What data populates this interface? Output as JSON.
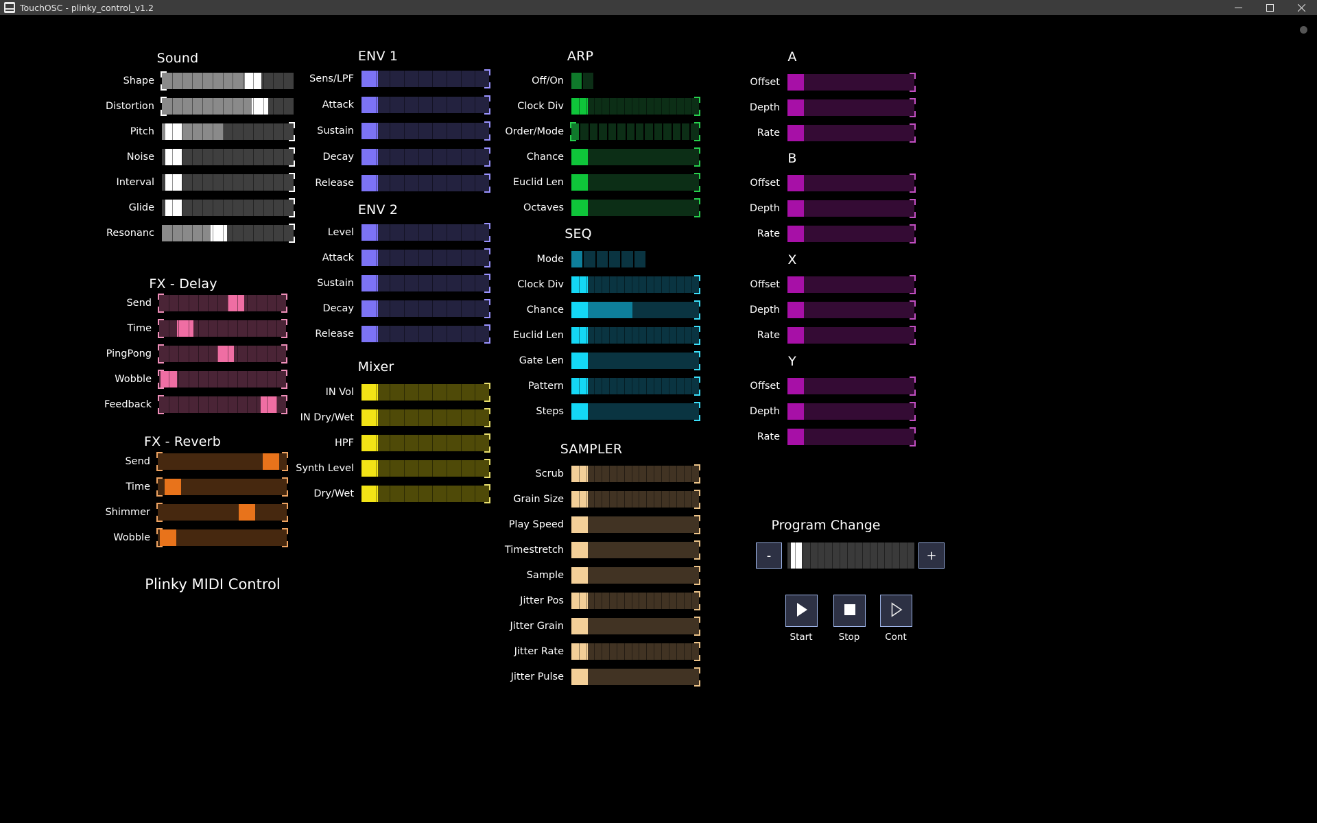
{
  "window": {
    "title": "TouchOSC - plinky_control_v1.2",
    "icon": "app-icon",
    "buttons": [
      {
        "name": "minimize",
        "glyph": "minimize-icon"
      },
      {
        "name": "maximize",
        "glyph": "maximize-icon"
      },
      {
        "name": "close",
        "glyph": "close-icon"
      }
    ]
  },
  "footer_title": "Plinky MIDI Control",
  "palettes": {
    "grey": {
      "track": "#3f3f3f",
      "fill": "#8a8a8a",
      "thumb": "#ffffff",
      "bracket": "#ffffff"
    },
    "blue": {
      "track": "#23223f",
      "fill": "#6c63e8",
      "thumb": "#7c73f5",
      "bracket": "#9a93ff"
    },
    "pink": {
      "track": "#4a2436",
      "fill": "#9c3c63",
      "thumb": "#ef6ea3",
      "bracket": "#f08fba"
    },
    "orange": {
      "track": "#46280f",
      "fill": "#8c4b17",
      "thumb": "#e8731b",
      "bracket": "#efa462"
    },
    "yellow": {
      "track": "#4f4a08",
      "fill": "#807a12",
      "thumb": "#f2e316",
      "bracket": "#e9df6e"
    },
    "green": {
      "track": "#0c2e16",
      "fill": "#0f7a2b",
      "thumb": "#0fc53a",
      "bracket": "#27d04d"
    },
    "cyan": {
      "track": "#0a3441",
      "fill": "#0e7f9b",
      "thumb": "#14d7f5",
      "bracket": "#3ce0fa"
    },
    "brown": {
      "track": "#413323",
      "fill": "#6b5436",
      "thumb": "#f3cf98",
      "bracket": "#edc489"
    },
    "purple": {
      "track": "#340b34",
      "fill": "#6a0f6a",
      "thumb": "#a710a7",
      "bracket": "#c24fc2"
    }
  },
  "groups": [
    {
      "id": "sound",
      "title": "Sound",
      "palette": "grey",
      "rows": [
        {
          "label": "Shape",
          "type": "fader",
          "fill": 0.72,
          "thumb": 0.72,
          "ticks": 13,
          "brackets": "left"
        },
        {
          "label": "Distortion",
          "type": "fader",
          "fill": 0.78,
          "thumb": 0.78,
          "ticks": 13,
          "brackets": "left"
        },
        {
          "label": "Pitch",
          "type": "fader",
          "fill": 0.47,
          "thumb": 0.03,
          "ticks": 13,
          "brackets": "right"
        },
        {
          "label": "Noise",
          "type": "fader",
          "fill": 0.0,
          "thumb": 0.03,
          "ticks": 13,
          "brackets": "right"
        },
        {
          "label": "Interval",
          "type": "fader",
          "fill": 0.0,
          "thumb": 0.03,
          "ticks": 13,
          "brackets": "right"
        },
        {
          "label": "Glide",
          "type": "fader",
          "fill": 0.0,
          "thumb": 0.03,
          "ticks": 13,
          "brackets": "right"
        },
        {
          "label": "Resonanc",
          "type": "fader",
          "fill": 0.42,
          "thumb": 0.42,
          "ticks": 13,
          "brackets": "right"
        }
      ]
    },
    {
      "id": "fx-delay",
      "title": "FX - Delay",
      "palette": "pink",
      "rows": [
        {
          "label": "Send",
          "type": "fader",
          "fill": 0.0,
          "thumb": 0.62,
          "ticks": 13,
          "brackets": "both"
        },
        {
          "label": "Time",
          "type": "fader",
          "fill": 0.0,
          "thumb": 0.16,
          "ticks": 13,
          "brackets": "both"
        },
        {
          "label": "PingPong",
          "type": "fader",
          "fill": 0.0,
          "thumb": 0.53,
          "ticks": 13,
          "brackets": "both"
        },
        {
          "label": "Wobble",
          "type": "fader",
          "fill": 0.0,
          "thumb": 0.01,
          "ticks": 13,
          "brackets": "both"
        },
        {
          "label": "Feedback",
          "type": "fader",
          "fill": 0.0,
          "thumb": 0.92,
          "ticks": 13,
          "brackets": "both"
        }
      ]
    },
    {
      "id": "fx-reverb",
      "title": "FX - Reverb",
      "palette": "orange",
      "rows": [
        {
          "label": "Send",
          "type": "fader",
          "fill": 0.0,
          "thumb": 0.93,
          "ticks": 0,
          "brackets": "both"
        },
        {
          "label": "Time",
          "type": "fader",
          "fill": 0.0,
          "thumb": 0.06,
          "ticks": 0,
          "brackets": "both"
        },
        {
          "label": "Shimmer",
          "type": "fader",
          "fill": 0.0,
          "thumb": 0.72,
          "ticks": 0,
          "brackets": "both"
        },
        {
          "label": "Wobble",
          "type": "fader",
          "fill": 0.0,
          "thumb": 0.02,
          "ticks": 0,
          "brackets": "both"
        }
      ]
    },
    {
      "id": "env1",
      "title": "ENV 1",
      "palette": "blue",
      "rows": [
        {
          "label": "Sens/LPF",
          "type": "fader",
          "fill": 0.0,
          "thumb": 0.0,
          "ticks": 9,
          "brackets": "right"
        },
        {
          "label": "Attack",
          "type": "fader",
          "fill": 0.0,
          "thumb": 0.0,
          "ticks": 9,
          "brackets": "right"
        },
        {
          "label": "Sustain",
          "type": "fader",
          "fill": 0.0,
          "thumb": 0.0,
          "ticks": 9,
          "brackets": "right"
        },
        {
          "label": "Decay",
          "type": "fader",
          "fill": 0.0,
          "thumb": 0.0,
          "ticks": 9,
          "brackets": "right"
        },
        {
          "label": "Release",
          "type": "fader",
          "fill": 0.0,
          "thumb": 0.0,
          "ticks": 9,
          "brackets": "right"
        }
      ]
    },
    {
      "id": "env2",
      "title": "ENV 2",
      "palette": "blue",
      "rows": [
        {
          "label": "Level",
          "type": "fader",
          "fill": 0.0,
          "thumb": 0.0,
          "ticks": 9,
          "brackets": "right"
        },
        {
          "label": "Attack",
          "type": "fader",
          "fill": 0.0,
          "thumb": 0.0,
          "ticks": 9,
          "brackets": "right"
        },
        {
          "label": "Sustain",
          "type": "fader",
          "fill": 0.0,
          "thumb": 0.0,
          "ticks": 9,
          "brackets": "right"
        },
        {
          "label": "Decay",
          "type": "fader",
          "fill": 0.0,
          "thumb": 0.0,
          "ticks": 9,
          "brackets": "right"
        },
        {
          "label": "Release",
          "type": "fader",
          "fill": 0.0,
          "thumb": 0.0,
          "ticks": 9,
          "brackets": "right"
        }
      ]
    },
    {
      "id": "mixer",
      "title": "Mixer",
      "palette": "yellow",
      "rows": [
        {
          "label": "IN Vol",
          "type": "fader",
          "fill": 0.0,
          "thumb": 0.0,
          "ticks": 9,
          "brackets": "right"
        },
        {
          "label": "IN Dry/Wet",
          "type": "fader",
          "fill": 0.0,
          "thumb": 0.0,
          "ticks": 9,
          "brackets": "right"
        },
        {
          "label": "HPF",
          "type": "fader",
          "fill": 0.0,
          "thumb": 0.0,
          "ticks": 9,
          "brackets": "right"
        },
        {
          "label": "Synth Level",
          "type": "fader",
          "fill": 0.0,
          "thumb": 0.0,
          "ticks": 9,
          "brackets": "right"
        },
        {
          "label": "Dry/Wet",
          "type": "fader",
          "fill": 0.0,
          "thumb": 0.0,
          "ticks": 9,
          "brackets": "right"
        }
      ]
    },
    {
      "id": "arp",
      "title": "ARP",
      "palette": "green",
      "rows": [
        {
          "label": "Off/On",
          "type": "segs",
          "count": 2,
          "active": 0,
          "width": 0.17,
          "brackets": "none"
        },
        {
          "label": "Clock Div",
          "type": "fader",
          "fill": 0.0,
          "thumb": 0.0,
          "ticks": 17,
          "brackets": "right"
        },
        {
          "label": "Order/Mode",
          "type": "segs",
          "count": 14,
          "active": 0,
          "width": 1.0,
          "brackets": "both"
        },
        {
          "label": "Chance",
          "type": "fader",
          "fill": 0.0,
          "thumb": 0.0,
          "ticks": 0,
          "brackets": "right"
        },
        {
          "label": "Euclid Len",
          "type": "fader",
          "fill": 0.0,
          "thumb": 0.0,
          "ticks": 0,
          "brackets": "right"
        },
        {
          "label": "Octaves",
          "type": "fader",
          "fill": 0.0,
          "thumb": 0.0,
          "ticks": 0,
          "brackets": "right"
        }
      ]
    },
    {
      "id": "seq",
      "title": "SEQ",
      "palette": "cyan",
      "rows": [
        {
          "label": "Mode",
          "type": "segs",
          "count": 6,
          "active": 0,
          "width": 0.58,
          "brackets": "none"
        },
        {
          "label": "Clock Div",
          "type": "fader",
          "fill": 0.0,
          "thumb": 0.0,
          "ticks": 17,
          "brackets": "right"
        },
        {
          "label": "Chance",
          "type": "fader",
          "fill": 0.48,
          "thumb": 0.0,
          "ticks": 0,
          "brackets": "right"
        },
        {
          "label": "Euclid Len",
          "type": "fader",
          "fill": 0.0,
          "thumb": 0.0,
          "ticks": 17,
          "brackets": "right"
        },
        {
          "label": "Gate Len",
          "type": "fader",
          "fill": 0.0,
          "thumb": 0.0,
          "ticks": 0,
          "brackets": "right"
        },
        {
          "label": "Pattern",
          "type": "fader",
          "fill": 0.0,
          "thumb": 0.0,
          "ticks": 17,
          "brackets": "right"
        },
        {
          "label": "Steps",
          "type": "fader",
          "fill": 0.0,
          "thumb": 0.0,
          "ticks": 0,
          "brackets": "right"
        }
      ]
    },
    {
      "id": "sampler",
      "title": "SAMPLER",
      "palette": "brown",
      "rows": [
        {
          "label": "Scrub",
          "type": "fader",
          "fill": 0.0,
          "thumb": 0.0,
          "ticks": 17,
          "brackets": "right"
        },
        {
          "label": "Grain Size",
          "type": "fader",
          "fill": 0.0,
          "thumb": 0.0,
          "ticks": 17,
          "brackets": "right"
        },
        {
          "label": "Play Speed",
          "type": "fader",
          "fill": 0.0,
          "thumb": 0.0,
          "ticks": 0,
          "brackets": "right"
        },
        {
          "label": "Timestretch",
          "type": "fader",
          "fill": 0.0,
          "thumb": 0.0,
          "ticks": 0,
          "brackets": "right"
        },
        {
          "label": "Sample",
          "type": "fader",
          "fill": 0.0,
          "thumb": 0.0,
          "ticks": 0,
          "brackets": "right"
        },
        {
          "label": "Jitter Pos",
          "type": "fader",
          "fill": 0.0,
          "thumb": 0.0,
          "ticks": 17,
          "brackets": "right"
        },
        {
          "label": "Jitter Grain",
          "type": "fader",
          "fill": 0.0,
          "thumb": 0.0,
          "ticks": 0,
          "brackets": "right"
        },
        {
          "label": "Jitter Rate",
          "type": "fader",
          "fill": 0.0,
          "thumb": 0.0,
          "ticks": 17,
          "brackets": "right"
        },
        {
          "label": "Jitter Pulse",
          "type": "fader",
          "fill": 0.0,
          "thumb": 0.0,
          "ticks": 0,
          "brackets": "right"
        }
      ]
    },
    {
      "id": "mod-a",
      "title": "A",
      "palette": "purple",
      "rows": [
        {
          "label": "Offset",
          "type": "fader",
          "fill": 0.0,
          "thumb": 0.0,
          "ticks": 0,
          "brackets": "right"
        },
        {
          "label": "Depth",
          "type": "fader",
          "fill": 0.0,
          "thumb": 0.0,
          "ticks": 0,
          "brackets": "right"
        },
        {
          "label": "Rate",
          "type": "fader",
          "fill": 0.0,
          "thumb": 0.0,
          "ticks": 0,
          "brackets": "right"
        }
      ]
    },
    {
      "id": "mod-b",
      "title": "B",
      "palette": "purple",
      "rows": [
        {
          "label": "Offset",
          "type": "fader",
          "fill": 0.0,
          "thumb": 0.0,
          "ticks": 0,
          "brackets": "right"
        },
        {
          "label": "Depth",
          "type": "fader",
          "fill": 0.0,
          "thumb": 0.0,
          "ticks": 0,
          "brackets": "right"
        },
        {
          "label": "Rate",
          "type": "fader",
          "fill": 0.0,
          "thumb": 0.0,
          "ticks": 0,
          "brackets": "right"
        }
      ]
    },
    {
      "id": "mod-x",
      "title": "X",
      "palette": "purple",
      "rows": [
        {
          "label": "Offset",
          "type": "fader",
          "fill": 0.0,
          "thumb": 0.0,
          "ticks": 0,
          "brackets": "right"
        },
        {
          "label": "Depth",
          "type": "fader",
          "fill": 0.0,
          "thumb": 0.0,
          "ticks": 0,
          "brackets": "right"
        },
        {
          "label": "Rate",
          "type": "fader",
          "fill": 0.0,
          "thumb": 0.0,
          "ticks": 0,
          "brackets": "right"
        }
      ]
    },
    {
      "id": "mod-y",
      "title": "Y",
      "palette": "purple",
      "rows": [
        {
          "label": "Offset",
          "type": "fader",
          "fill": 0.0,
          "thumb": 0.0,
          "ticks": 0,
          "brackets": "right"
        },
        {
          "label": "Depth",
          "type": "fader",
          "fill": 0.0,
          "thumb": 0.0,
          "ticks": 0,
          "brackets": "right"
        },
        {
          "label": "Rate",
          "type": "fader",
          "fill": 0.0,
          "thumb": 0.0,
          "ticks": 0,
          "brackets": "right"
        }
      ]
    }
  ],
  "program_change": {
    "title": "Program Change",
    "minus_label": "-",
    "plus_label": "+",
    "value_position": 0.03
  },
  "transport": [
    {
      "name": "start",
      "label": "Start",
      "glyph": "play-icon",
      "filled": true
    },
    {
      "name": "stop",
      "label": "Stop",
      "glyph": "stop-icon",
      "filled": true
    },
    {
      "name": "cont",
      "label": "Cont",
      "glyph": "play-outline-icon",
      "filled": false
    }
  ]
}
